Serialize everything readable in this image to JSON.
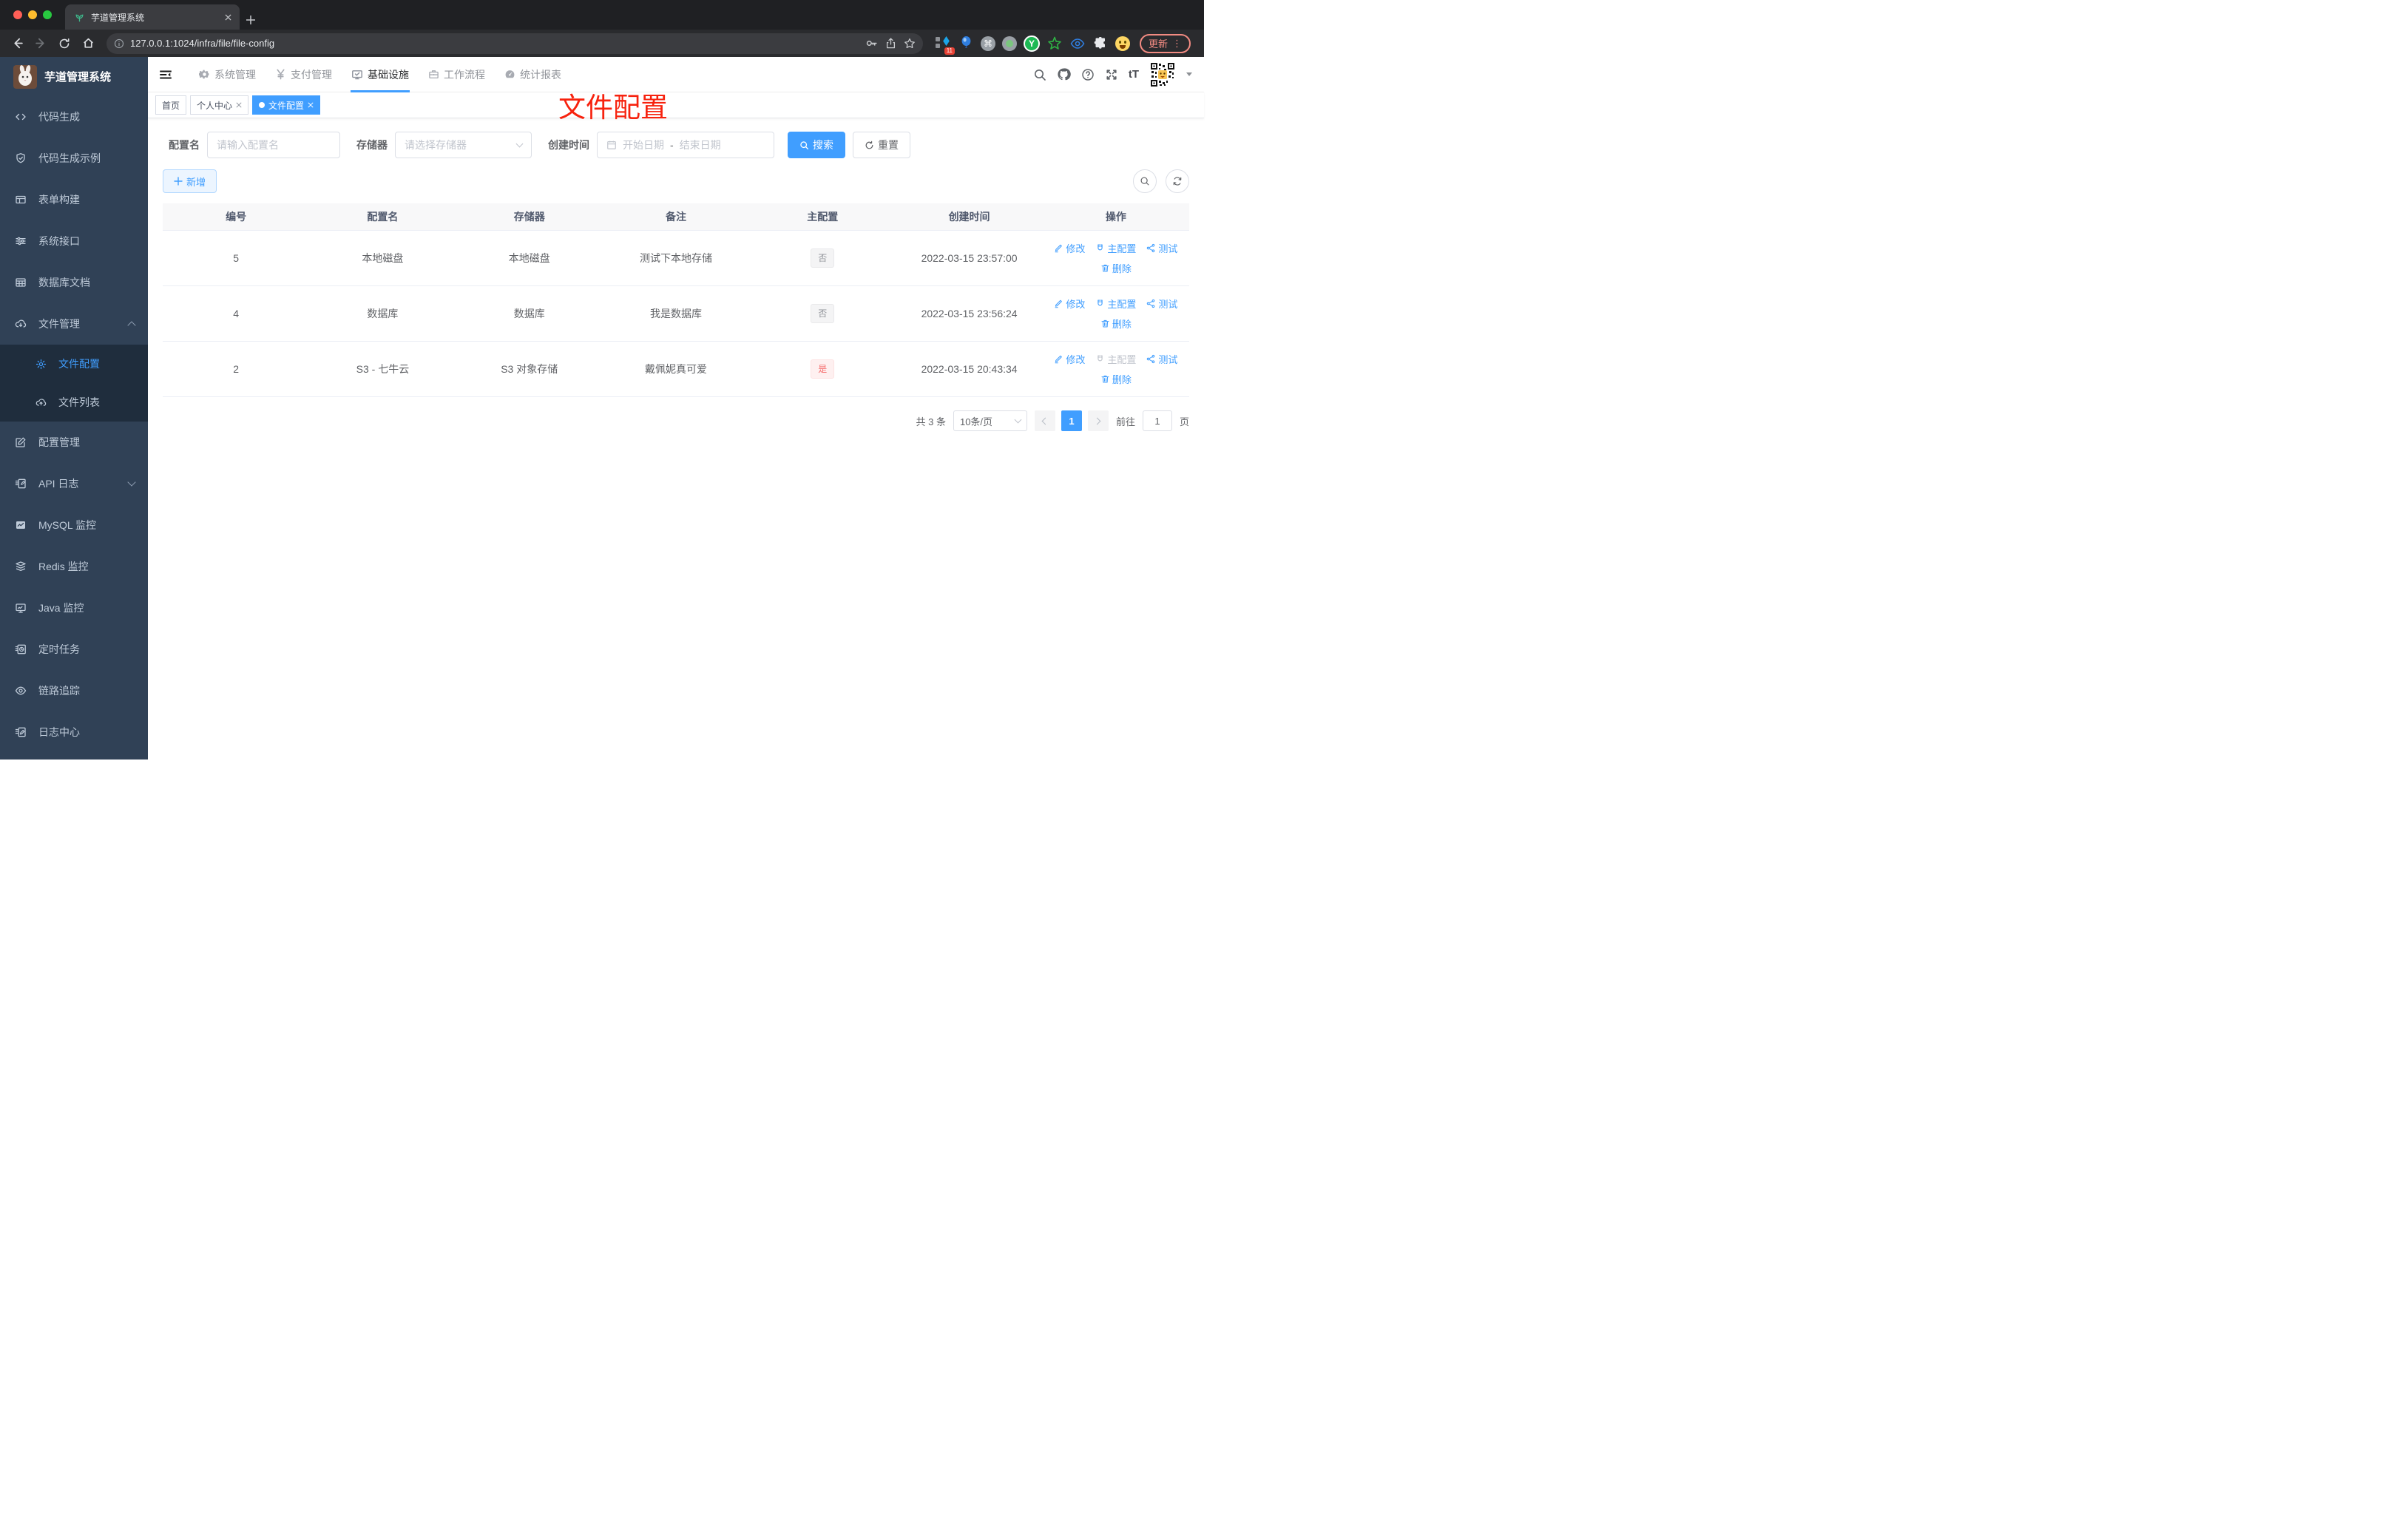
{
  "browser": {
    "tab_title": "芋道管理系统",
    "url": "127.0.0.1:1024/infra/file/file-config",
    "extensions_badge": "11",
    "update_label": "更新",
    "cmd_glyph": "⌘",
    "y_glyph": "Y",
    "menu_dots": "⋮",
    "close_glyph": "✕",
    "plus_glyph": "+"
  },
  "sidebar": {
    "title": "芋道管理系统",
    "items": [
      {
        "label": "代码生成"
      },
      {
        "label": "代码生成示例"
      },
      {
        "label": "表单构建"
      },
      {
        "label": "系统接口"
      },
      {
        "label": "数据库文档"
      },
      {
        "label": "文件管理",
        "expanded": true,
        "children": [
          {
            "label": "文件配置",
            "active": true
          },
          {
            "label": "文件列表"
          }
        ]
      },
      {
        "label": "配置管理"
      },
      {
        "label": "API 日志"
      },
      {
        "label": "MySQL 监控"
      },
      {
        "label": "Redis 监控"
      },
      {
        "label": "Java 监控"
      },
      {
        "label": "定时任务"
      },
      {
        "label": "链路追踪"
      },
      {
        "label": "日志中心"
      }
    ]
  },
  "header": {
    "nav": [
      {
        "label": "系统管理"
      },
      {
        "label": "支付管理"
      },
      {
        "label": "基础设施",
        "active": true
      },
      {
        "label": "工作流程"
      },
      {
        "label": "统计报表"
      }
    ],
    "font_size_glyph": "tT"
  },
  "tags": [
    {
      "label": "首页"
    },
    {
      "label": "个人中心",
      "closable": true
    },
    {
      "label": "文件配置",
      "closable": true,
      "active": true
    }
  ],
  "overlay_title": "文件配置",
  "filters": {
    "name_label": "配置名",
    "name_placeholder": "请输入配置名",
    "storage_label": "存储器",
    "storage_placeholder": "请选择存储器",
    "created_label": "创建时间",
    "date_start_placeholder": "开始日期",
    "date_separator": "-",
    "date_end_placeholder": "结束日期",
    "search_label": "搜索",
    "reset_label": "重置"
  },
  "toolbar": {
    "add_label": "新增"
  },
  "table": {
    "headers": [
      "编号",
      "配置名",
      "存储器",
      "备注",
      "主配置",
      "创建时间",
      "操作"
    ],
    "actions": {
      "edit": "修改",
      "master": "主配置",
      "test": "测试",
      "delete": "删除"
    },
    "rows": [
      {
        "id": "5",
        "name": "本地磁盘",
        "storage": "本地磁盘",
        "remark": "测试下本地存储",
        "master": "否",
        "master_type": "info",
        "created": "2022-03-15 23:57:00"
      },
      {
        "id": "4",
        "name": "数据库",
        "storage": "数据库",
        "remark": "我是数据库",
        "master": "否",
        "master_type": "info",
        "created": "2022-03-15 23:56:24"
      },
      {
        "id": "2",
        "name": "S3 - 七牛云",
        "storage": "S3 对象存储",
        "remark": "戴佩妮真可爱",
        "master": "是",
        "master_type": "danger",
        "created": "2022-03-15 20:43:34"
      }
    ]
  },
  "pagination": {
    "total": "共 3 条",
    "page_size": "10条/页",
    "page": "1",
    "goto_label": "前往",
    "goto_value": "1",
    "unit_label": "页"
  },
  "colors": {
    "primary": "#409eff",
    "danger": "#f56c6c",
    "overlay_red": "#f7220e",
    "sidebar_bg": "#304156"
  }
}
